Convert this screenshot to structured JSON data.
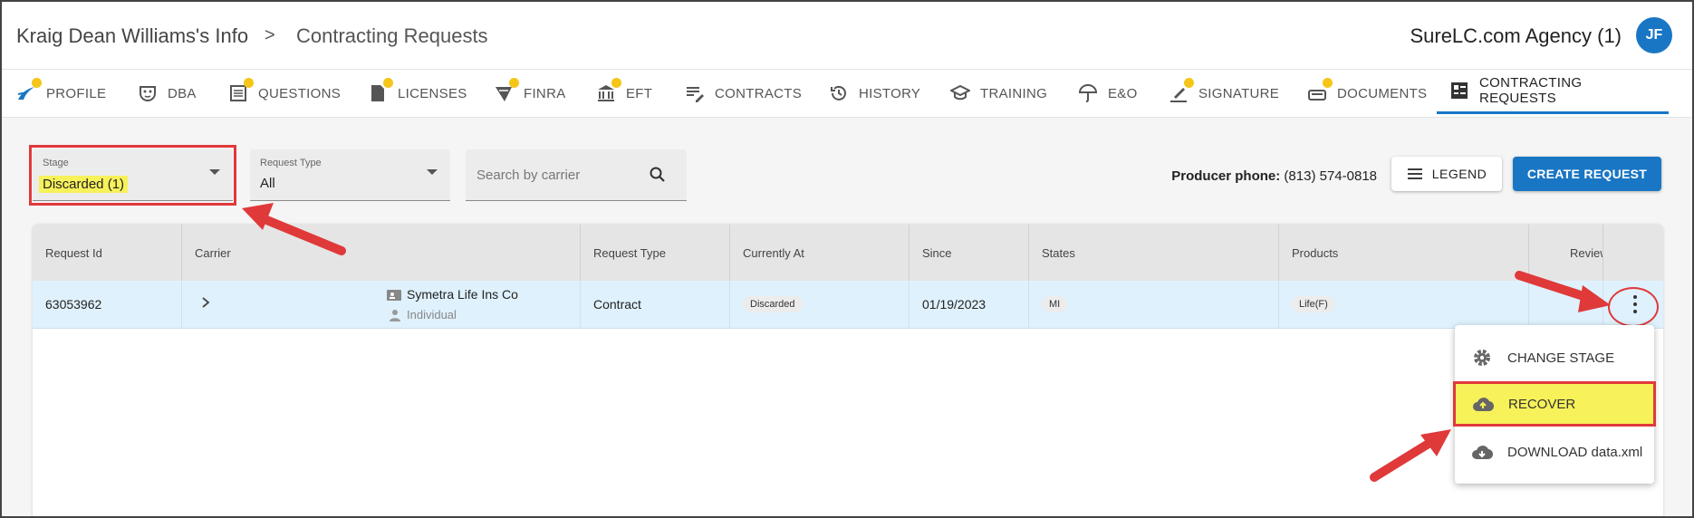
{
  "header": {
    "breadcrumb_1": "Kraig Dean Williams's Info",
    "breadcrumb_sep": ">",
    "breadcrumb_2": "Contracting Requests",
    "agency": "SureLC.com Agency (1)",
    "avatar_initials": "JF"
  },
  "tabs": [
    {
      "label": "PROFILE",
      "icon": "profile-icon",
      "dot": true
    },
    {
      "label": "DBA",
      "icon": "mask-icon",
      "dot": false
    },
    {
      "label": "QUESTIONS",
      "icon": "questions-icon",
      "dot": true
    },
    {
      "label": "LICENSES",
      "icon": "license-icon",
      "dot": true
    },
    {
      "label": "FINRA",
      "icon": "finra-icon",
      "dot": true
    },
    {
      "label": "EFT",
      "icon": "bank-icon",
      "dot": true
    },
    {
      "label": "CONTRACTS",
      "icon": "contracts-icon",
      "dot": false
    },
    {
      "label": "HISTORY",
      "icon": "history-icon",
      "dot": false
    },
    {
      "label": "TRAINING",
      "icon": "training-icon",
      "dot": false
    },
    {
      "label": "E&O",
      "icon": "umbrella-icon",
      "dot": false
    },
    {
      "label": "SIGNATURE",
      "icon": "signature-icon",
      "dot": true
    },
    {
      "label": "DOCUMENTS",
      "icon": "documents-icon",
      "dot": true
    },
    {
      "label": "CONTRACTING REQUESTS",
      "icon": "contracting-requests-icon",
      "dot": false,
      "active": true
    }
  ],
  "filters": {
    "stage_label": "Stage",
    "stage_value": "Discarded (1)",
    "request_type_label": "Request Type",
    "request_type_value": "All",
    "search_placeholder": "Search by carrier"
  },
  "producer": {
    "label": "Producer phone:",
    "phone": "(813) 574-0818"
  },
  "buttons": {
    "legend": "LEGEND",
    "create_request": "CREATE REQUEST"
  },
  "table": {
    "columns": [
      "Request Id",
      "Carrier",
      "Request Type",
      "Currently At",
      "Since",
      "States",
      "Products",
      "Review"
    ],
    "rows": [
      {
        "request_id": "63053962",
        "carrier": "Symetra Life Ins Co",
        "carrier_type": "Individual",
        "request_type": "Contract",
        "currently_at": "Discarded",
        "since": "01/19/2023",
        "states": "MI",
        "products": "Life(F)"
      }
    ]
  },
  "menu": {
    "items": [
      {
        "label": "CHANGE STAGE",
        "icon": "gear-icon"
      },
      {
        "label": "RECOVER",
        "icon": "cloud-upload-icon"
      },
      {
        "label": "DOWNLOAD data.xml",
        "icon": "cloud-download-icon"
      }
    ]
  },
  "colors": {
    "accent": "#1976c4",
    "highlight": "#f7f15a",
    "annotation": "#e0393a",
    "tab_dot": "#f5c518"
  }
}
